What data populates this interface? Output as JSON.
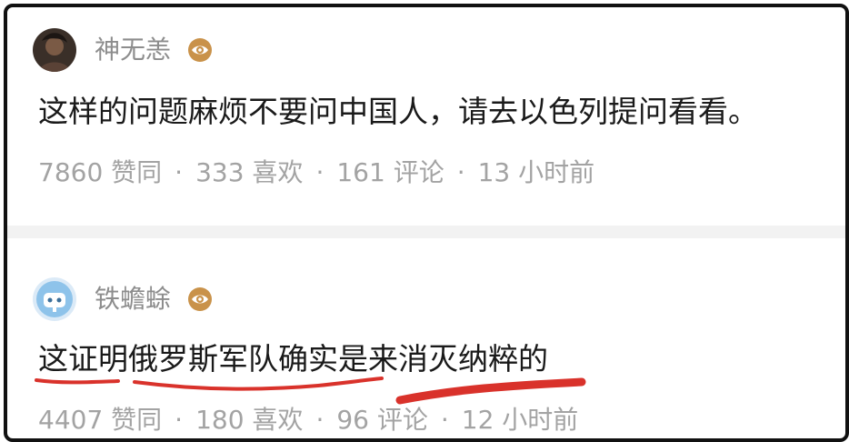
{
  "comments": [
    {
      "username": "神无恙",
      "avatar_icon": "dark-portrait-avatar",
      "badge_icon": "eye-badge-icon",
      "text": "这样的问题麻烦不要问中国人，请去以色列提问看看。",
      "likes": "7860 赞同",
      "favorites": "333 喜欢",
      "comments_count": "161 评论",
      "time": "13 小时前"
    },
    {
      "username": "铁蟾蜍",
      "avatar_icon": "blue-cartoon-avatar",
      "badge_icon": "eye-badge-icon",
      "text": "这证明俄罗斯军队确实是来消灭纳粹的",
      "likes": "4407 赞同",
      "favorites": "180 喜欢",
      "comments_count": "96 评论",
      "time": "12 小时前"
    }
  ],
  "separator_dot": "·",
  "colors": {
    "text": "#1a1a1a",
    "meta": "#a3a3a3",
    "username": "#8d8d8d",
    "badge": "#c9924a",
    "annotation": "#d9322b"
  }
}
